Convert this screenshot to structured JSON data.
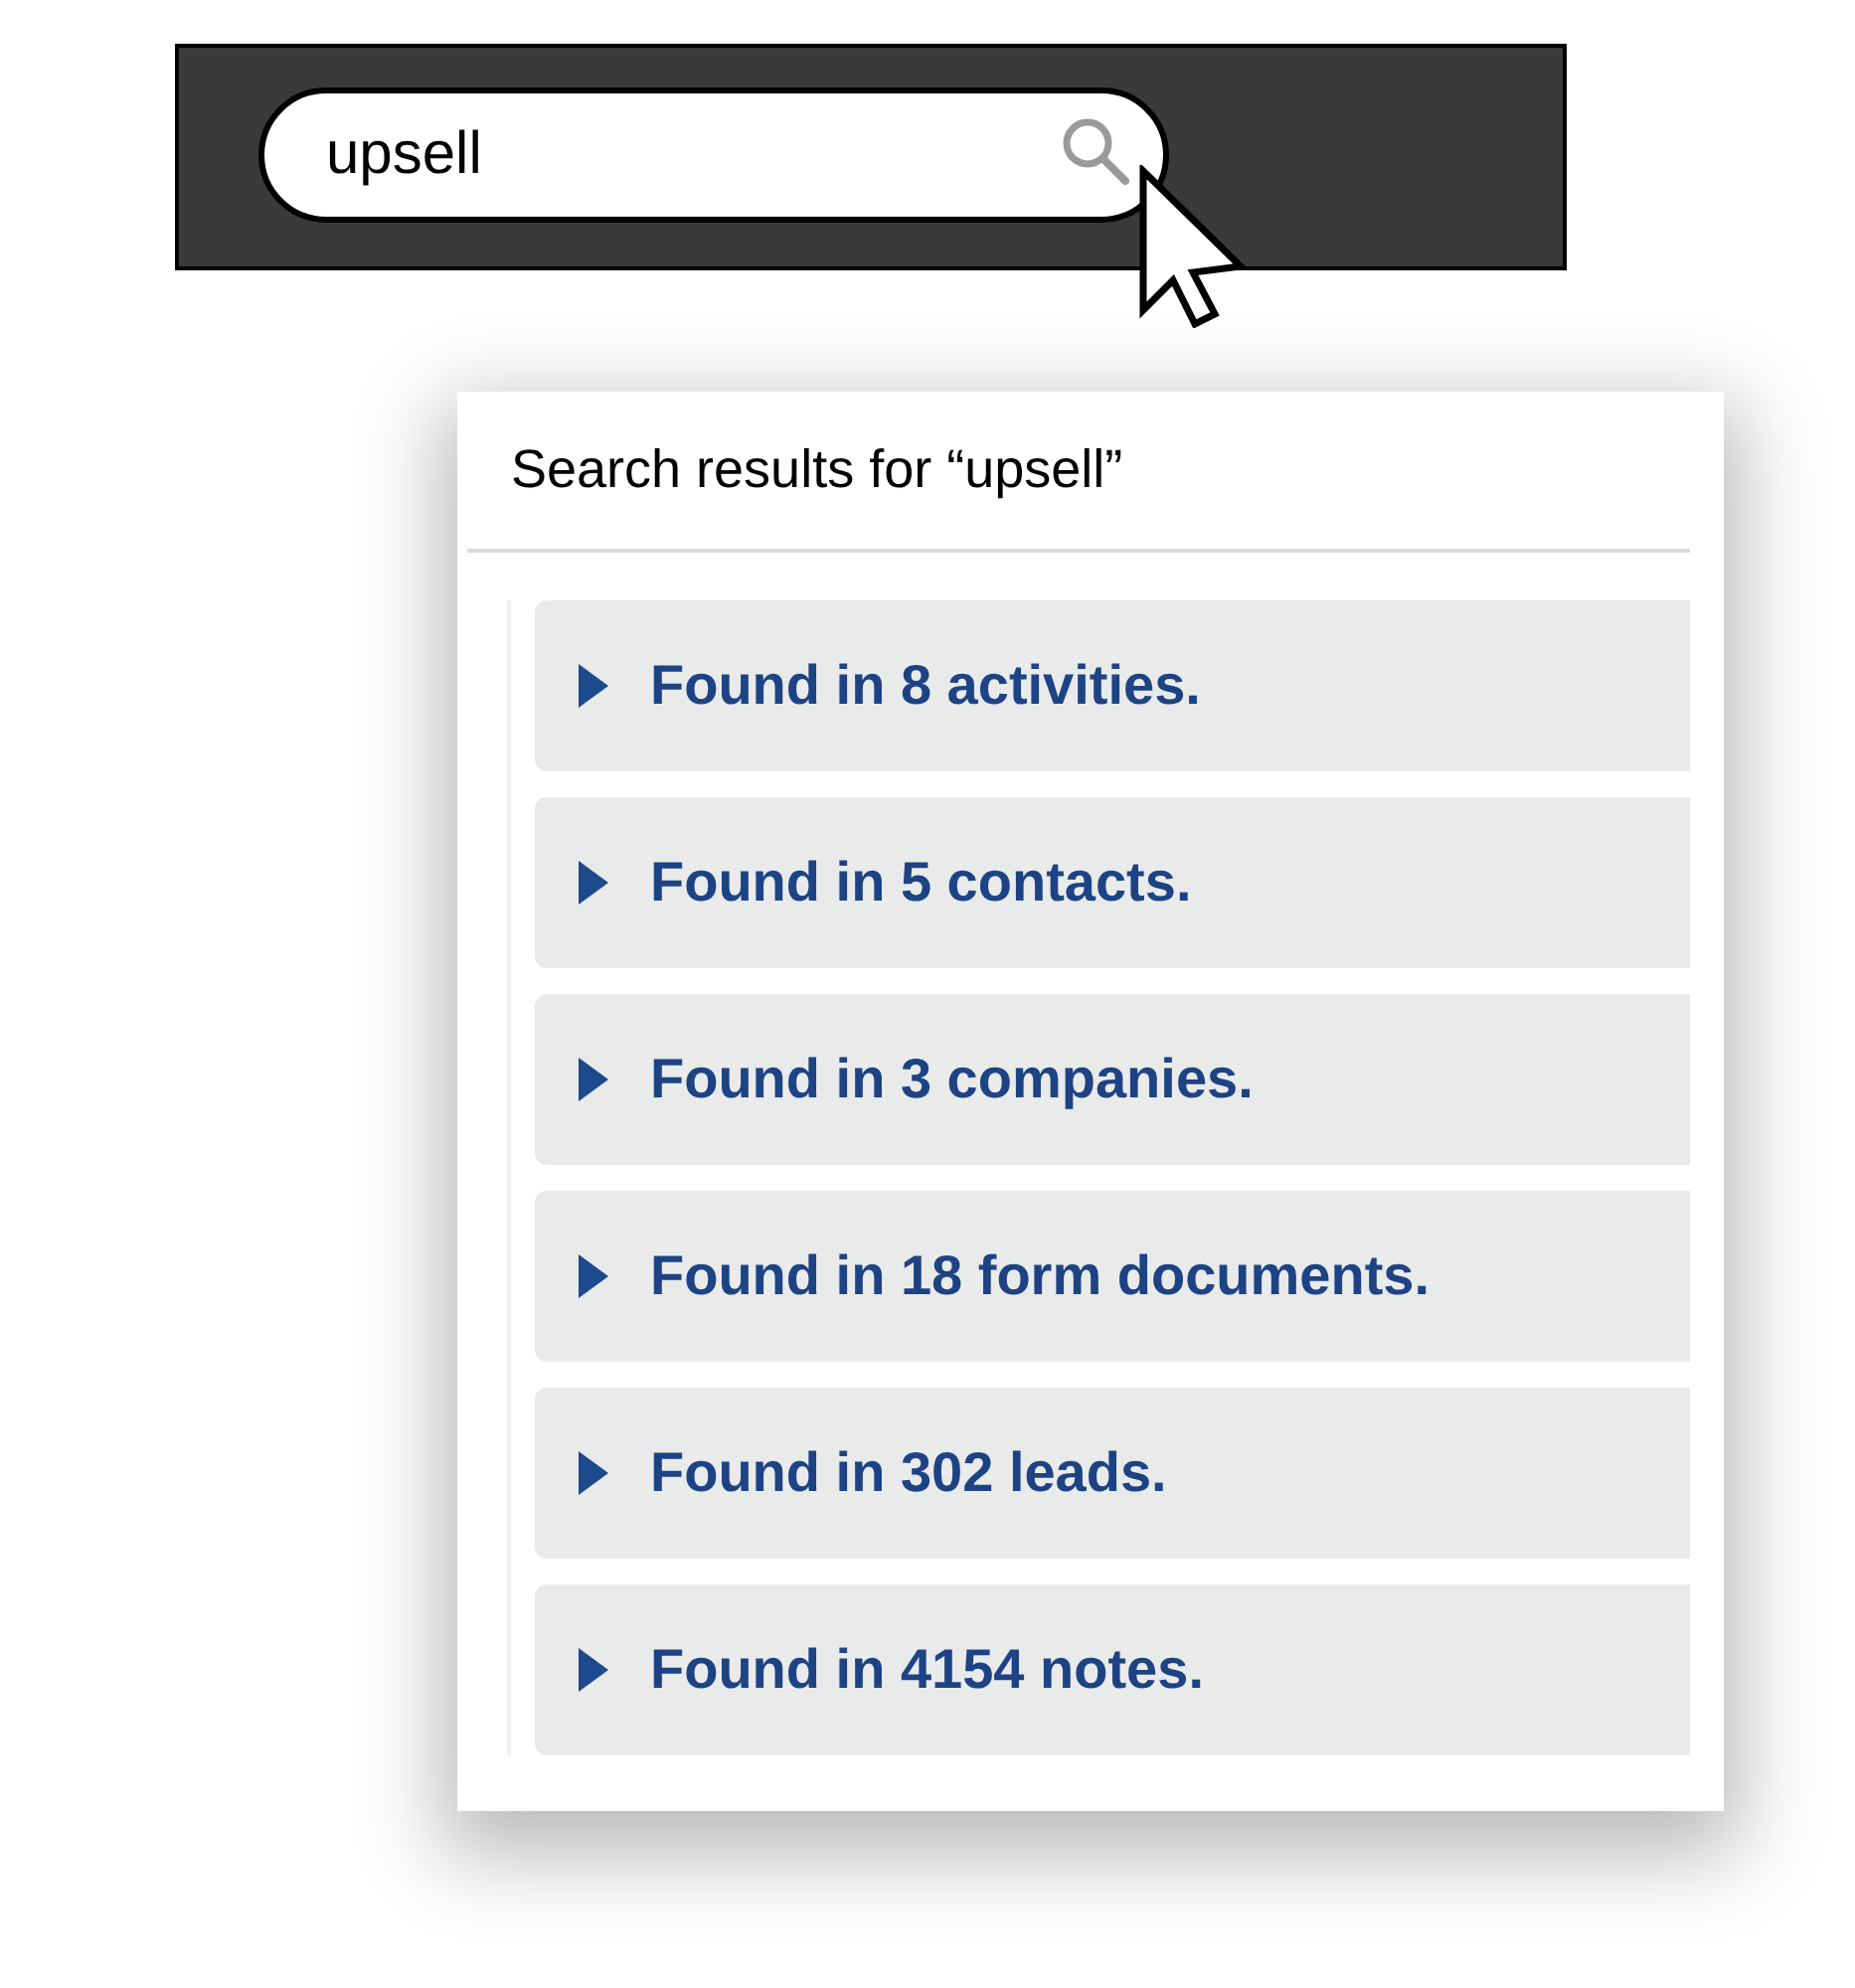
{
  "search_bar": {
    "query": "upsell"
  },
  "results_panel": {
    "title": "Search results for “upsell”",
    "groups": [
      {
        "label": "Found in 8 activities.",
        "expanded": false
      },
      {
        "label": "Found in 5 contacts.",
        "expanded": false
      },
      {
        "label": "Found in 3 companies.",
        "expanded": false
      },
      {
        "label": "Found in 18 form documents.",
        "expanded": false
      },
      {
        "label": "Found in 302 leads.",
        "expanded": false
      },
      {
        "label": "Found in 4154 notes.",
        "expanded": false
      }
    ]
  }
}
